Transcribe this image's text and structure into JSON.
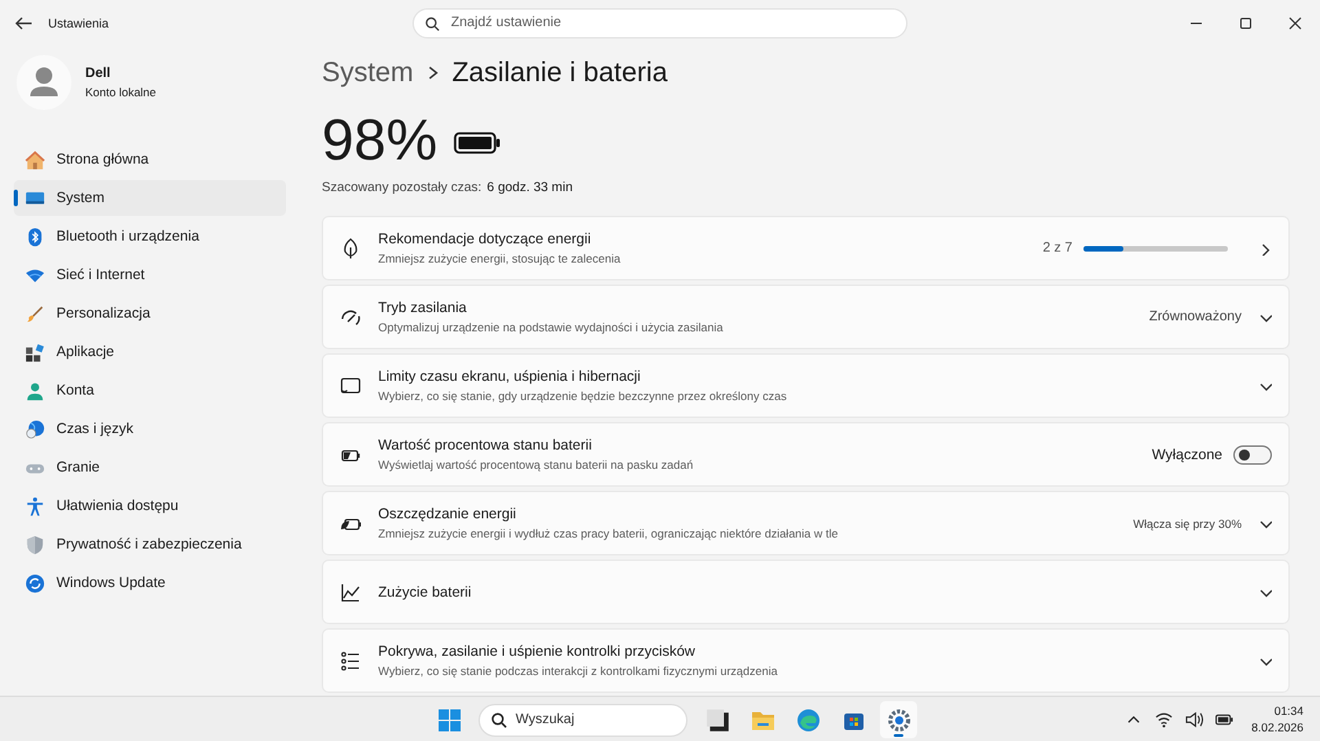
{
  "window": {
    "title": "Ustawienia",
    "search_placeholder": "Znajdź ustawienie"
  },
  "account": {
    "name": "Dell",
    "type": "Konto lokalne"
  },
  "sidebar": {
    "items": [
      {
        "label": "Strona główna",
        "selected": false
      },
      {
        "label": "System",
        "selected": true
      },
      {
        "label": "Bluetooth i urządzenia",
        "selected": false
      },
      {
        "label": "Sieć i Internet",
        "selected": false
      },
      {
        "label": "Personalizacja",
        "selected": false
      },
      {
        "label": "Aplikacje",
        "selected": false
      },
      {
        "label": "Konta",
        "selected": false
      },
      {
        "label": "Czas i język",
        "selected": false
      },
      {
        "label": "Granie",
        "selected": false
      },
      {
        "label": "Ułatwienia dostępu",
        "selected": false
      },
      {
        "label": "Prywatność i zabezpieczenia",
        "selected": false
      },
      {
        "label": "Windows Update",
        "selected": false
      }
    ]
  },
  "breadcrumb": [
    "System",
    "Zasilanie i bateria"
  ],
  "battery": {
    "percent": "98%",
    "estimate_label": "Szacowany pozostały czas:",
    "estimate_value": "6 godz. 33 min"
  },
  "cards": [
    {
      "kind": "progress",
      "title": "Rekomendacje dotyczące energii",
      "subtitle": "Zmniejsz zużycie energii, stosując te zalecenia",
      "reading": "2 z 7",
      "level": 0.28
    },
    {
      "kind": "dropdown",
      "title": "Tryb zasilania",
      "subtitle": "Optymalizuj urządzenie na podstawie wydajności i użycia zasilania",
      "value": "Zrównoważony"
    },
    {
      "kind": "expand",
      "title": "Limity czasu ekranu, uśpienia i hibernacji",
      "subtitle": "Wybierz, co się stanie, gdy urządzenie będzie bezczynne przez określony czas"
    },
    {
      "kind": "toggle",
      "title": "Wartość procentowa stanu baterii",
      "subtitle": "Wyświetlaj wartość procentową stanu baterii na pasku zadań",
      "value": "Wyłączone",
      "on": false
    },
    {
      "kind": "expand",
      "title": "Oszczędzanie energii",
      "subtitle": "Zmniejsz zużycie energii i wydłuż czas pracy baterii, ograniczając niektóre działania w tle",
      "value": "Włącza się przy 30%"
    },
    {
      "kind": "expand",
      "title": "Zużycie baterii"
    },
    {
      "kind": "expand",
      "title": "Pokrywa, zasilanie i uśpienie kontrolki przycisków",
      "subtitle": "Wybierz, co się stanie podczas interakcji z kontrolkami fizycznymi urządzenia"
    }
  ],
  "taskbar": {
    "search_placeholder": "Wyszukaj",
    "apps": [
      {
        "selected": false
      },
      {
        "selected": false
      },
      {
        "selected": false
      },
      {
        "selected": false
      },
      {
        "selected": true
      }
    ],
    "time": "01:34",
    "date": "8.02.2026"
  }
}
